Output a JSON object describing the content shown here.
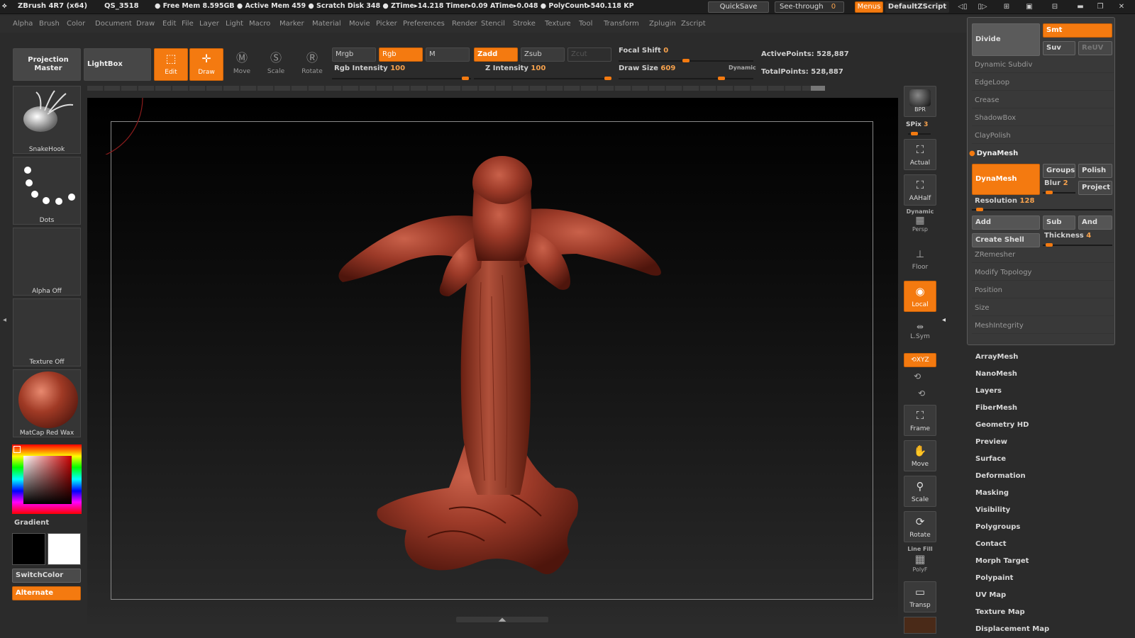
{
  "titlebar": {
    "app": "ZBrush 4R7 (x64)",
    "doc": "QS_3518",
    "stats": "● Free Mem 8.595GB ● Active Mem 459 ● Scratch Disk 348 ●  ZTime▸14.218 Timer▸0.09 ATime▸0.048 ● PolyCount▸540.118 KP",
    "quicksave": "QuickSave",
    "seethrough": "See-through",
    "seethrough_value": "0",
    "menus": "Menus",
    "script": "DefaultZScript"
  },
  "menus": [
    "Alpha",
    "Brush",
    "Color",
    "Document",
    "Draw",
    "Edit",
    "File",
    "Layer",
    "Light",
    "Macro",
    "Marker",
    "Material",
    "Movie",
    "Picker",
    "Preferences",
    "Render",
    "Stencil",
    "Stroke",
    "Texture",
    "Tool",
    "Transform",
    "Zplugin",
    "Zscript"
  ],
  "left": {
    "projection_master": "Projection Master",
    "lightbox": "LightBox",
    "brush": "SnakeHook",
    "stroke": "Dots",
    "alpha": "Alpha Off",
    "texture": "Texture Off",
    "material": "MatCap Red Wax",
    "gradient": "Gradient",
    "switchcolor": "SwitchColor",
    "alternate": "Alternate"
  },
  "toolbar": {
    "edit": "Edit",
    "draw": "Draw",
    "move": "Move",
    "scale": "Scale",
    "rotate": "Rotate",
    "mrgb": "Mrgb",
    "rgb": "Rgb",
    "m": "M",
    "zadd": "Zadd",
    "zsub": "Zsub",
    "zcut": "Zcut",
    "rgb_intensity_label": "Rgb Intensity",
    "rgb_intensity": "100",
    "z_intensity_label": "Z Intensity",
    "z_intensity": "100",
    "focal_shift_label": "Focal Shift",
    "focal_shift": "0",
    "draw_size_label": "Draw Size",
    "draw_size": "609",
    "dynamic": "Dynamic",
    "active_points": "ActivePoints: 528,887",
    "total_points": "TotalPoints: 528,887"
  },
  "right_shelf": {
    "bpr": "BPR",
    "spix_label": "SPix",
    "spix": "3",
    "actual": "Actual",
    "aahalf": "AAHalf",
    "dynamic": "Dynamic",
    "persp": "Persp",
    "floor": "Floor",
    "local": "Local",
    "lsym": "L.Sym",
    "xyz": "XYZ",
    "frame": "Frame",
    "move": "Move",
    "scale": "Scale",
    "rotate": "Rotate",
    "linefill": "Line Fill",
    "polyf": "PolyF",
    "transp": "Transp"
  },
  "palette": {
    "divide": "Divide",
    "smt": "Smt",
    "suv": "Suv",
    "reuv": "ReUV",
    "items": [
      "Dynamic Subdiv",
      "EdgeLoop",
      "Crease",
      "ShadowBox",
      "ClayPolish"
    ],
    "dynamesh_header": "DynaMesh",
    "dynamesh_btn": "DynaMesh",
    "groups": "Groups",
    "polish": "Polish",
    "blur_label": "Blur",
    "blur": "2",
    "project": "Project",
    "resolution_label": "Resolution",
    "resolution": "128",
    "add": "Add",
    "sub": "Sub",
    "and": "And",
    "create_shell": "Create Shell",
    "thickness_label": "Thickness",
    "thickness": "4",
    "items2": [
      "ZRemesher",
      "Modify Topology",
      "Position",
      "Size",
      "MeshIntegrity"
    ]
  },
  "subpalettes": [
    "ArrayMesh",
    "NanoMesh",
    "Layers",
    "FiberMesh",
    "Geometry HD",
    "Preview",
    "Surface",
    "Deformation",
    "Masking",
    "Visibility",
    "Polygroups",
    "Contact",
    "Morph Target",
    "Polypaint",
    "UV Map",
    "Texture Map",
    "Displacement Map"
  ]
}
